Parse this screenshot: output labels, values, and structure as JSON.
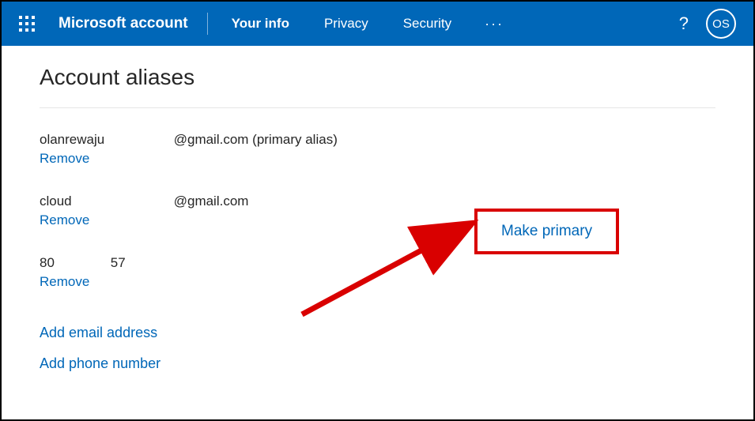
{
  "header": {
    "brand": "Microsoft account",
    "nav": {
      "your_info": "Your info",
      "privacy": "Privacy",
      "security": "Security",
      "more": "···"
    },
    "help": "?",
    "avatar_initials": "OS"
  },
  "page": {
    "title": "Account aliases",
    "aliases": [
      {
        "name": "olanrewaju",
        "domain": "@gmail.com (primary alias)",
        "remove": "Remove"
      },
      {
        "name": "cloud",
        "domain": "@gmail.com",
        "remove": "Remove"
      },
      {
        "n1": "80",
        "n2": "57",
        "remove": "Remove"
      }
    ],
    "make_primary": "Make primary",
    "add_email": "Add email address",
    "add_phone": "Add phone number"
  }
}
